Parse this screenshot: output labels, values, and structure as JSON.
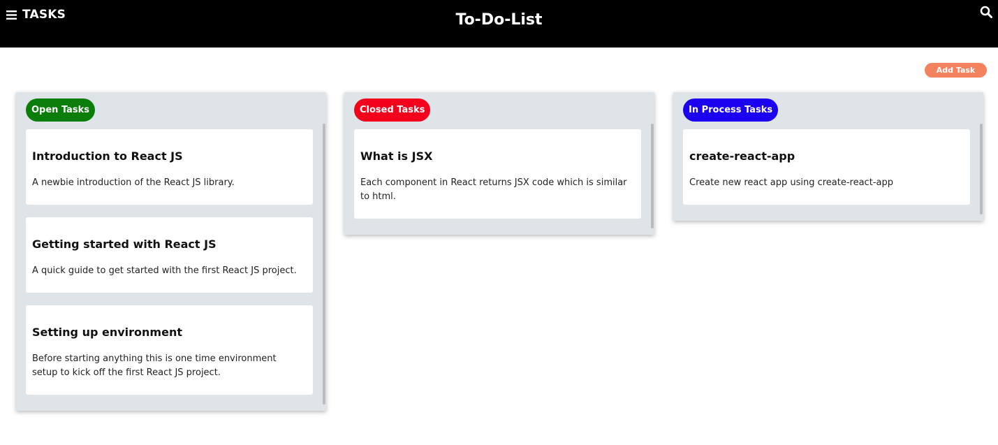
{
  "header": {
    "brand_label": "TASKS",
    "title": "To-Do-List",
    "menu_icon": "hamburger-menu-icon",
    "search_icon": "search-icon",
    "background": "#000000",
    "text_color": "#ffffff"
  },
  "toolbar": {
    "add_task_label": "Add Task",
    "add_task_color": "#f5825f"
  },
  "columns": [
    {
      "label": "Open Tasks",
      "color": "#0a7d0a",
      "tasks": [
        {
          "title": "Introduction to React JS",
          "description": "A newbie introduction of the React JS library."
        },
        {
          "title": "Getting started with React JS",
          "description": "A quick guide to get started with the first React JS project."
        },
        {
          "title": "Setting up environment",
          "description": "Before starting anything this is one time environment setup to kick off the first React JS project."
        }
      ]
    },
    {
      "label": "Closed Tasks",
      "color": "#f2001c",
      "tasks": [
        {
          "title": "What is JSX",
          "description": "Each component in React returns JSX code which is similar to html."
        }
      ]
    },
    {
      "label": "In Process Tasks",
      "color": "#1c00f0",
      "tasks": [
        {
          "title": "create-react-app",
          "description": "Create new react app using create-react-app"
        }
      ]
    }
  ],
  "column_background": "#dee4e7"
}
